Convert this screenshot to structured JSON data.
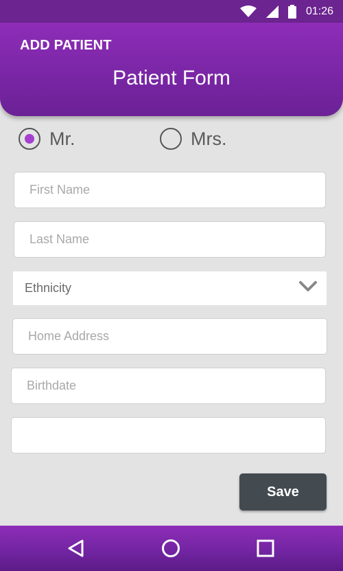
{
  "status_bar": {
    "time": "01:26",
    "icons": [
      "wifi-icon",
      "signal-icon",
      "battery-icon"
    ]
  },
  "header": {
    "app_title": "ADD PATIENT",
    "form_title": "Patient Form"
  },
  "title_options": [
    {
      "label": "Mr.",
      "selected": true
    },
    {
      "label": "Mrs.",
      "selected": false
    }
  ],
  "fields": {
    "first_name": {
      "placeholder": "First Name",
      "value": ""
    },
    "last_name": {
      "placeholder": "Last Name",
      "value": ""
    },
    "ethnicity": {
      "selected": "Ethnicity",
      "icon": "chevron-down-icon"
    },
    "home_address": {
      "placeholder": "Home Address",
      "value": ""
    },
    "birthdate": {
      "placeholder": "Birthdate",
      "value": ""
    },
    "extra": {
      "placeholder": "",
      "value": ""
    }
  },
  "actions": {
    "save_label": "Save"
  },
  "nav_bar": {
    "icons": [
      "back-icon",
      "home-icon",
      "recents-icon"
    ]
  },
  "colors": {
    "primary": "#8e2db8",
    "radio_accent": "#a53fcf",
    "save_button": "#434a50",
    "background": "#e3e3e3"
  }
}
